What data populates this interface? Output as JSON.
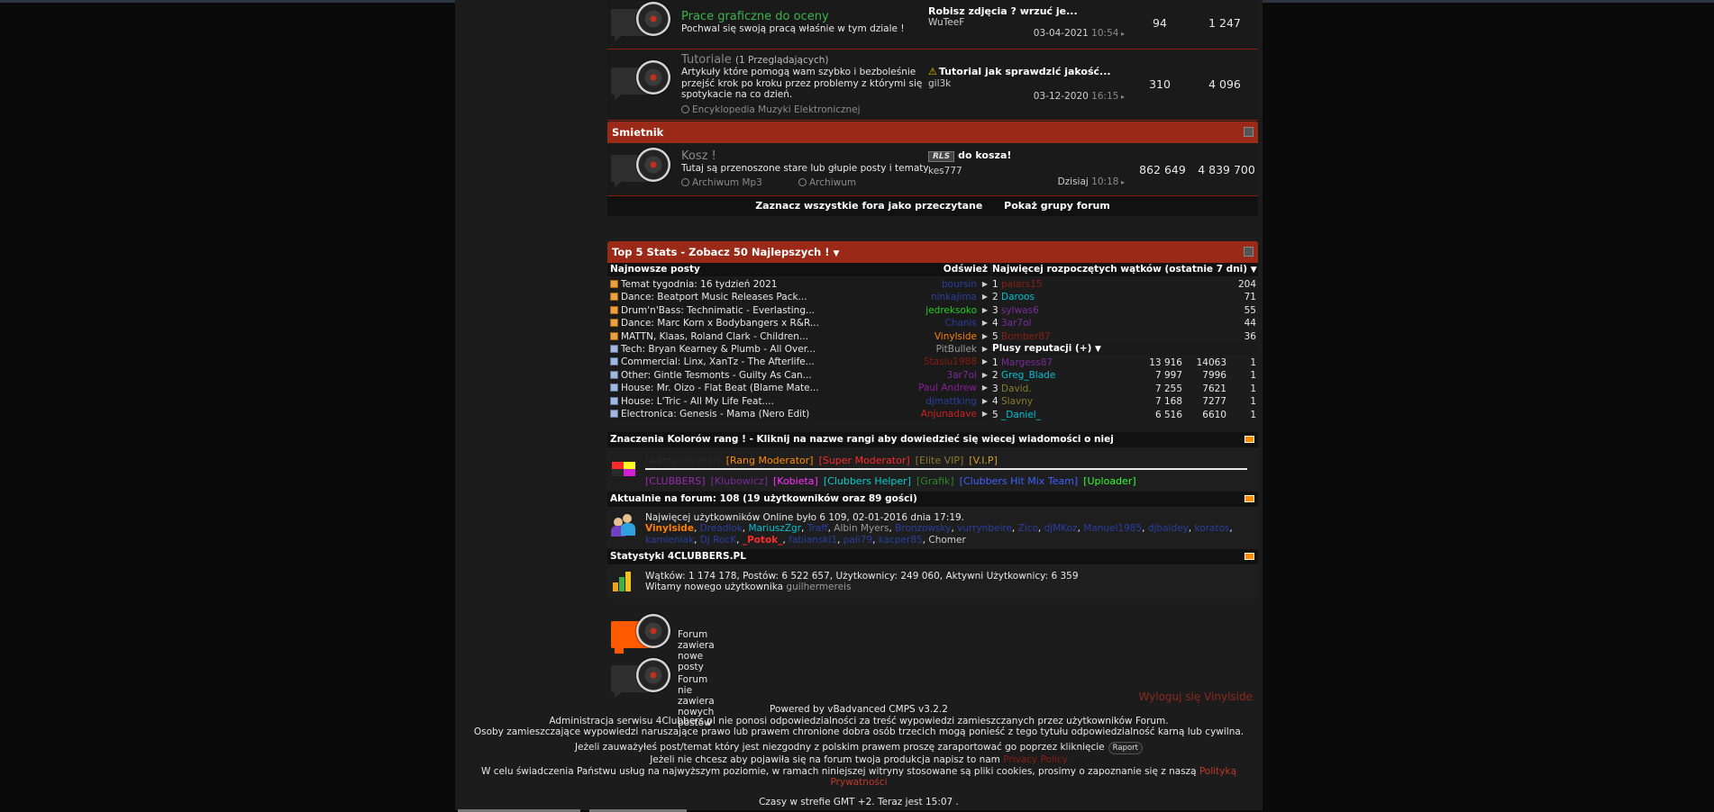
{
  "forums": [
    {
      "title": "Prace graficzne do oceny",
      "viewers": "",
      "description": "Pochwal się swoją pracą właśnie w tym dziale !",
      "subforums": [],
      "last_post_title": "Robisz zdjęcia ? wrzuć je...",
      "last_post_author": "WuTeeF",
      "last_post_date": "03-04-2021",
      "last_post_time": "10:54",
      "threads": "94",
      "posts": "1 247"
    },
    {
      "title": "Tutoriale",
      "viewers": "(1 Przeglądających)",
      "description": "Artykuły które pomogą wam szybko i bezboleśnie przejść krok po kroku przez problemy z którymi się spotykacie na co dzień.",
      "subforums": [
        "Encyklopedia Muzyki Elektronicznej"
      ],
      "last_post_title": "Tutorial jak sprawdzić jakość...",
      "last_post_author": "gil3k",
      "last_post_date": "03-12-2020",
      "last_post_time": "16:15",
      "threads": "310",
      "posts": "4 096"
    }
  ],
  "trash_section": {
    "header": "Smietnik",
    "forum": {
      "title": "Kosz !",
      "description": "Tutaj są przenoszone stare lub głupie posty i tematy",
      "subforums": [
        "Archiwum Mp3",
        "Archiwum"
      ],
      "last_post_title": "do kosza!",
      "last_post_badge": "RLS",
      "last_post_author": "kes777",
      "last_post_date": "Dzisiaj",
      "last_post_time": "10:18",
      "threads": "862 649",
      "posts": "4 839 700"
    }
  },
  "forum_footer": {
    "mark_read": "Zaznacz wszystkie fora jako przeczytane",
    "show_groups": "Pokaż grupy forum"
  },
  "stats": {
    "header": "Top 5 Stats - Zobacz 50 Najlepszych !",
    "newest_posts_label": "Najnowsze posty",
    "refresh_label": "Odśwież",
    "top_threads_label": "Najwięcej rozpoczętych wątków (ostatnie 7 dni)",
    "reputation_label": "Plusy reputacji (+)",
    "newest_posts": [
      {
        "title": "Temat tygodnia: 16 tydzień 2021",
        "user": "boursin",
        "color": "#2a3ea0"
      },
      {
        "title": "Dance: Beatport Music Releases Pack...",
        "user": "ninkajima",
        "color": "#2a3ea0"
      },
      {
        "title": "Drum'n'Bass: Technimatic - Everlasting...",
        "user": "jedreksoko",
        "color": "#22cc22"
      },
      {
        "title": "Dance: Marc Korn x Bodybangers x R&R...",
        "user": "Chanis",
        "color": "#2a3ea0"
      },
      {
        "title": "MATTN, Klaas, Roland Clark - Children...",
        "user": "Vinylside",
        "color": "#ff7f00"
      },
      {
        "title": "Tech: Bryan Kearney & Plumb - All Over...",
        "user": "PitBullek",
        "color": "#9a9a9a"
      },
      {
        "title": "Commercial: Linx, XanTz - The Afterlife...",
        "user": "Stasiu1988",
        "color": "#8a1d12"
      },
      {
        "title": "Other: Gintle Tesmonts - Guilty As Can...",
        "user": "3ar7ol",
        "color": "#7a2c9a"
      },
      {
        "title": "House: Mr. Oizo - Flat Beat (Blame Mate...",
        "user": "Paul Andrew",
        "color": "#8a1d9a"
      },
      {
        "title": "House: L'Tric - All My Life Feat....",
        "user": "djmattking",
        "color": "#2a3ea0"
      },
      {
        "title": "Electronica: Genesis - Mama (Nero Edit)",
        "user": "Anjunadave",
        "color": "#d02020"
      }
    ],
    "top_threads": [
      {
        "rank": "1",
        "name": "palars15",
        "color": "#8a1d12",
        "value": "204"
      },
      {
        "rank": "2",
        "name": "Daroos",
        "color": "#00c0d0",
        "value": "71"
      },
      {
        "rank": "3",
        "name": "sylwas6",
        "color": "#7a2c9a",
        "value": "55"
      },
      {
        "rank": "4",
        "name": "3ar7ol",
        "color": "#7a2c9a",
        "value": "44"
      },
      {
        "rank": "5",
        "name": "Bomber87",
        "color": "#8a1d12",
        "value": "36"
      }
    ],
    "reputation": [
      {
        "rank": "1",
        "name": "Margess87",
        "color": "#7a2c9a",
        "v1": "13 916",
        "v2": "14063",
        "v3": "1"
      },
      {
        "rank": "2",
        "name": "Greg_Blade",
        "color": "#00c0d0",
        "v1": "7 997",
        "v2": "7996",
        "v3": "1"
      },
      {
        "rank": "3",
        "name": "David.",
        "color": "#8a7a2a",
        "v1": "7 255",
        "v2": "7621",
        "v3": "1"
      },
      {
        "rank": "4",
        "name": "Slavny",
        "color": "#8a7a2a",
        "v1": "7 168",
        "v2": "7277",
        "v3": "1"
      },
      {
        "rank": "5",
        "name": "_Daniel_",
        "color": "#00c0d0",
        "v1": "6 516",
        "v2": "6610",
        "v3": "1"
      }
    ]
  },
  "ranks": {
    "header": "Znaczenia Kolorów rang ! - Kliknij na nazwe rangi aby dowiedzieć się wiecej wiadomości o niej",
    "row1": [
      {
        "label": "[Administrator]",
        "color": "#2a2a2a"
      },
      {
        "label": "[Rang Moderator]",
        "color": "#ff8c00"
      },
      {
        "label": "[Super Moderator]",
        "color": "#ff2a2a"
      },
      {
        "label": "[Elite VIP]",
        "color": "#8a7a2a"
      },
      {
        "label": "[V.I.P]",
        "color": "#d0a020"
      }
    ],
    "row2": [
      {
        "label": "[CLUBBERS]",
        "color": "#9a2ab0"
      },
      {
        "label": "[Klubowicz]",
        "color": "#7a2c9a"
      },
      {
        "label": "[Kobieta]",
        "color": "#ff30ff"
      },
      {
        "label": "[Clubbers Helper]",
        "color": "#00d0d0"
      },
      {
        "label": "[Grafik]",
        "color": "#2a8a2a"
      },
      {
        "label": "[Clubbers Hit Mix Team]",
        "color": "#4060ff"
      },
      {
        "label": "[Uploader]",
        "color": "#30ff30"
      }
    ]
  },
  "online": {
    "header": "Aktualnie na forum: 108 (19 użytkowników oraz 89 gości)",
    "record": "Najwięcej użytkowników Online było 6 109, 02-01-2016 dnia 17:19.",
    "users": [
      {
        "name": "Vinylside",
        "color": "#ff7f00"
      },
      {
        "name": "Dreadlok",
        "color": "#2a3ea0"
      },
      {
        "name": "MariuszZgr",
        "color": "#00c0d0"
      },
      {
        "name": "Traff",
        "color": "#2a3ea0"
      },
      {
        "name": "Albin Myers",
        "color": "#9a9a9a"
      },
      {
        "name": "Bronzowsky",
        "color": "#2a3ea0"
      },
      {
        "name": "vurrynbeire",
        "color": "#2a3ea0"
      },
      {
        "name": "Zico",
        "color": "#2a3ea0"
      },
      {
        "name": "djMKoz",
        "color": "#2a3ea0"
      },
      {
        "name": "Manuel1985",
        "color": "#2a3ea0"
      },
      {
        "name": "djbaldey",
        "color": "#2a3ea0"
      },
      {
        "name": "koratos",
        "color": "#2a3ea0"
      },
      {
        "name": "kamieniak",
        "color": "#2a3ea0"
      },
      {
        "name": "DJ RocK",
        "color": "#2a3ea0"
      },
      {
        "name": "_Potok_",
        "color": "#ff2a2a"
      },
      {
        "name": "fabianski1",
        "color": "#2a3ea0"
      },
      {
        "name": "pali79",
        "color": "#2a3ea0"
      },
      {
        "name": "kacper85",
        "color": "#2a3ea0"
      },
      {
        "name": "Chomer",
        "color": "#cfcfcf"
      }
    ]
  },
  "board_stats": {
    "header": "Statystyki 4CLUBBERS.PL",
    "line1": "Wątków: 1 174 178, Postów: 6 522 657, Użytkownicy: 249 060, Aktywni Użytkownicy: 6 359",
    "welcome": "Witamy nowego użytkownika",
    "new_user": "guilhermereis"
  },
  "legend": {
    "new_posts": "Forum zawiera nowe posty",
    "no_new_posts": "Forum nie zawiera nowych postów"
  },
  "logout": "Wyloguj się Vinylside",
  "footer": {
    "powered": "Powered by vBadvanced CMPS v3.2.2",
    "line1": "Administracja serwisu 4Clubbers.pl nie ponosi odpowiedzialności za treść wypowiedzi zamieszczanych przez użytkowników Forum.",
    "line2": "Osoby zamieszczające wypowiedzi naruszające prawo lub prawem chronione dobra osób trzecich mogą ponieść z tego tytułu odpowiedzialność karną lub cywilna.",
    "line3": "Jeżeli zauważyłeś post/temat który jest niezgodny z polskim prawem proszę zaraportować go poprzez kliknięcie",
    "raport": "Raport",
    "line4_a": "Jeżeli nie chcesz aby pojawiła się na forum twoja produkcja napisz to nam",
    "privacy_policy": "Privacy Policy",
    "line5_a": "W celu świadczenia Państwu usług na najwyższym poziomie, w ramach niniejszej witryny stosowane są pliki cookies, prosimy o zapoznanie się z naszą",
    "privacy_link": "Polityką Prywatności",
    "time": "Czasy w strefie GMT +2. Teraz jest 15:07 ."
  }
}
